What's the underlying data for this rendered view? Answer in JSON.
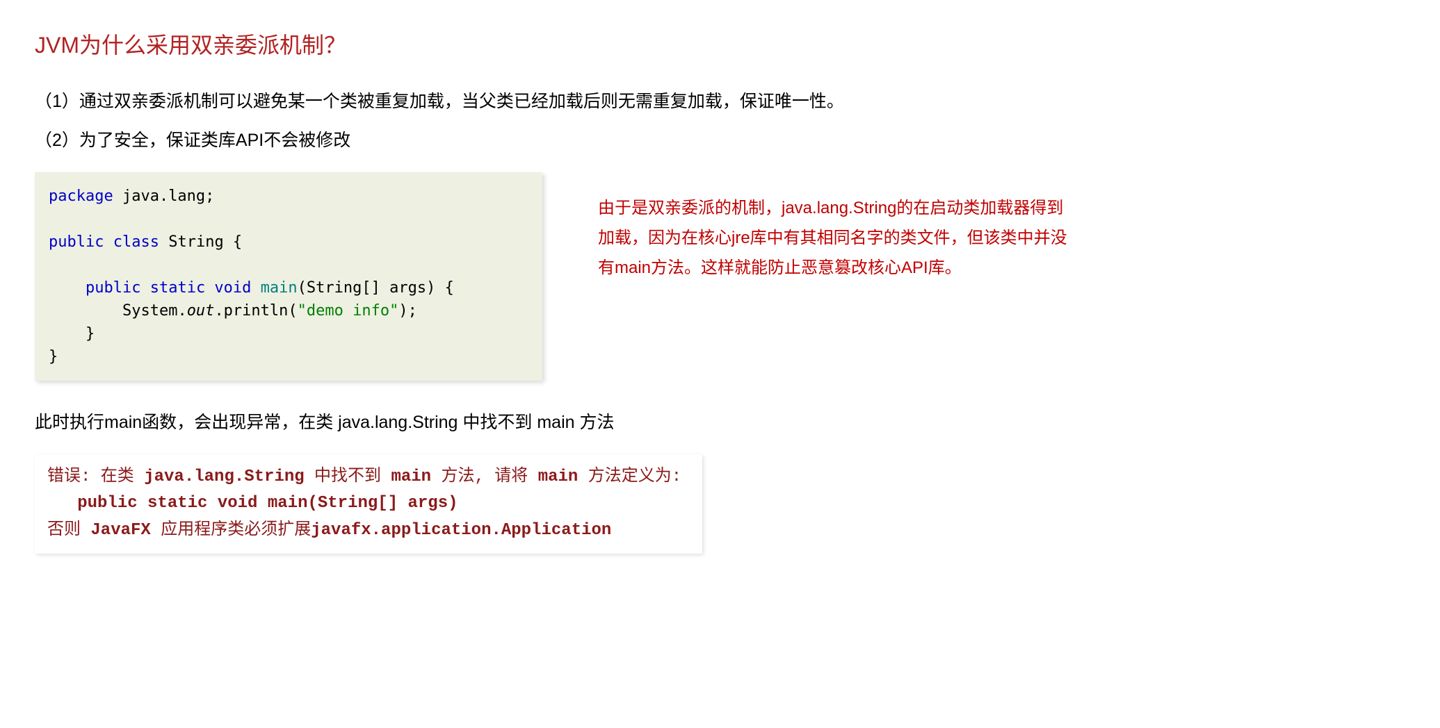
{
  "title": "JVM为什么采用双亲委派机制？",
  "point1": "（1）通过双亲委派机制可以避免某一个类被重复加载，当父类已经加载后则无需重复加载，保证唯一性。",
  "point2": "（2）为了安全，保证类库API不会被修改",
  "code": {
    "kw_package": "package",
    "pkg_name": " java.lang;",
    "kw_public1": "public",
    "kw_class": " class",
    "class_name": " String {",
    "indent1": "    ",
    "kw_public2": "public",
    "kw_static": " static",
    "kw_void": " void",
    "method_name": " main",
    "params": "(String[] args) {",
    "indent2": "        ",
    "sys": "System.",
    "out": "out",
    "println": ".println(",
    "str": "\"demo info\"",
    "close_paren": ");",
    "indent_brace": "    }",
    "close_brace": "}"
  },
  "explanation": "由于是双亲委派的机制，java.lang.String的在启动类加载器得到加载，因为在核心jre库中有其相同名字的类文件，但该类中并没有main方法。这样就能防止恶意篡改核心API库。",
  "body_text": "此时执行main函数，会出现异常，在类 java.lang.String 中找不到 main 方法",
  "error": {
    "p1": "错误",
    "p2": ": 在类 ",
    "p3": "java.lang.String",
    "p4": " 中找不到 ",
    "p5": "main",
    "p6": " 方法, 请将 ",
    "p7": "main",
    "p8": " 方法定义为:",
    "line2": "   public static void main(String[] args)",
    "p9": "否则 ",
    "p10": "JavaFX",
    "p11": " 应用程序类必须扩展",
    "p12": "javafx.application.Application"
  }
}
